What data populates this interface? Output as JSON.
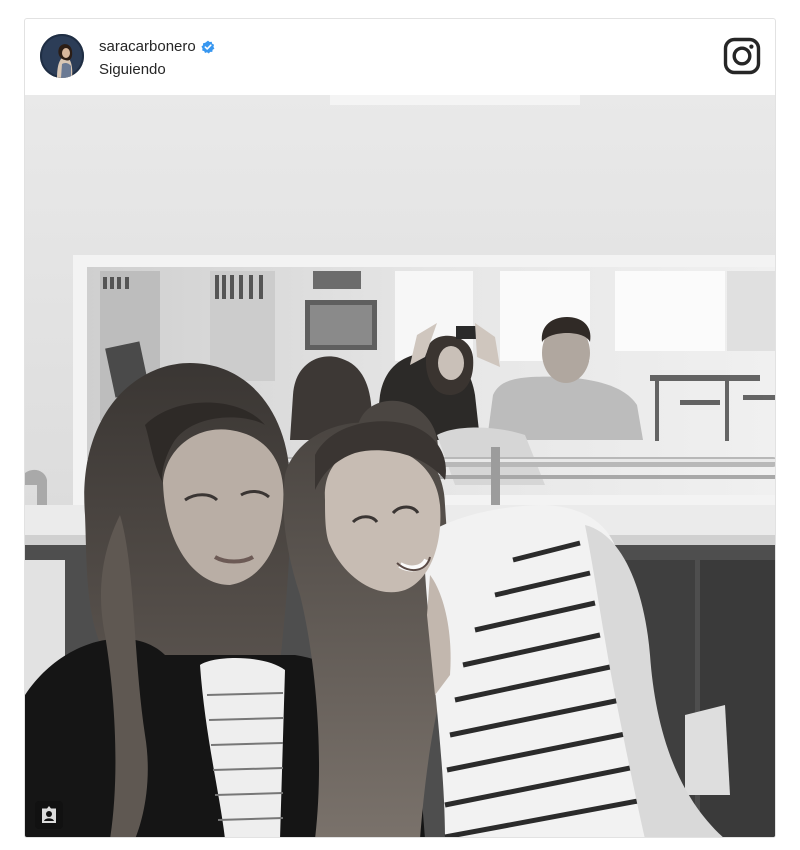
{
  "post": {
    "username": "saracarbonero",
    "verified": true,
    "follow_status": "Siguiendo"
  },
  "icons": {
    "verified": "verified-badge-icon",
    "brand": "instagram-logo-icon",
    "tagged_users": "user-tag-icon"
  },
  "colors": {
    "text": "#262626",
    "verified": "#3897f0",
    "border": "#e2e2e2"
  }
}
